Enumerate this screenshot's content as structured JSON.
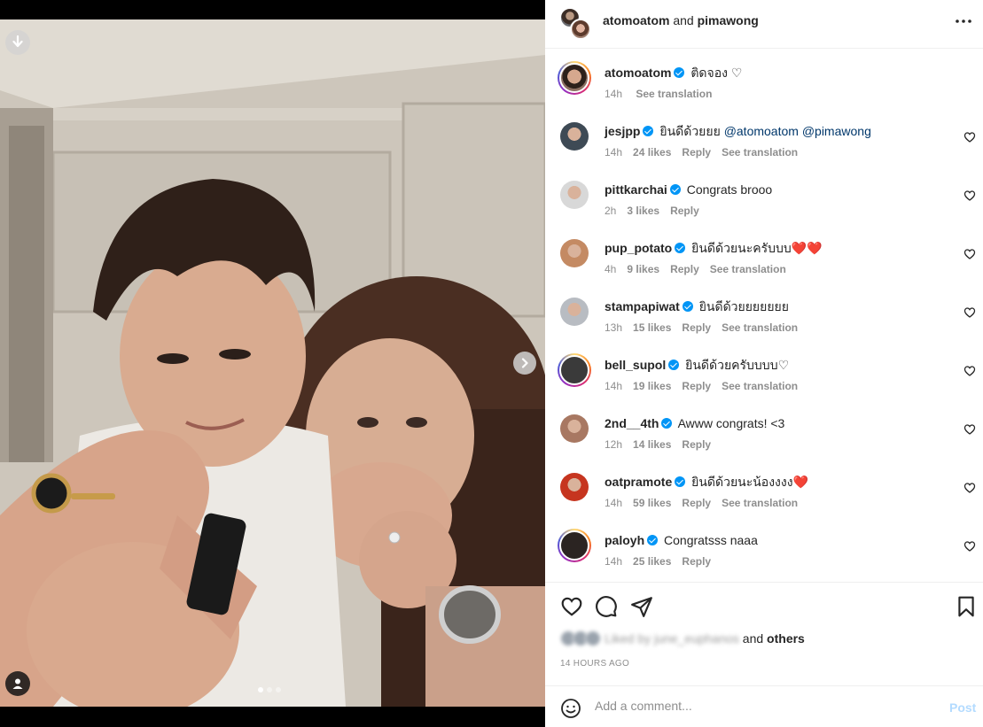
{
  "header": {
    "owner": "atomoatom",
    "joiner": "and",
    "collaborator": "pimawong",
    "more_icon": "more-horizontal-icon"
  },
  "caption": {
    "username": "atomoatom",
    "text": "ติดจอง",
    "emoji": "♡",
    "time": "14h",
    "translate": "See translation"
  },
  "comments": [
    {
      "username": "jesjpp",
      "text": "ยินดีด้วยยย",
      "mentions": [
        "@atomoatom",
        "@pimawong"
      ],
      "time": "14h",
      "likes": "24 likes",
      "reply": "Reply",
      "translate": "See translation",
      "avatar_color": "#3e4a55"
    },
    {
      "username": "pittkarchai",
      "text": "Congrats brooo",
      "mentions": [],
      "time": "2h",
      "likes": "3 likes",
      "reply": "Reply",
      "translate": "",
      "avatar_color": "#d8d8d8"
    },
    {
      "username": "pup_potato",
      "text": "ยินดีด้วยนะครับบบ❤️❤️",
      "mentions": [],
      "time": "4h",
      "likes": "9 likes",
      "reply": "Reply",
      "translate": "See translation",
      "avatar_color": "#c48a63"
    },
    {
      "username": "stampapiwat",
      "text": "ยินดีด้วยยยยยยย",
      "mentions": [],
      "time": "13h",
      "likes": "15 likes",
      "reply": "Reply",
      "translate": "See translation",
      "avatar_color": "#b8bcc2"
    },
    {
      "username": "bell_supol",
      "text": "ยินดีด้วยครับบบบ♡",
      "mentions": [],
      "time": "14h",
      "likes": "19 likes",
      "reply": "Reply",
      "translate": "See translation",
      "avatar_color": "#3a3a3a"
    },
    {
      "username": "2nd__4th",
      "text": "Awww congrats! <3",
      "mentions": [],
      "time": "12h",
      "likes": "14 likes",
      "reply": "Reply",
      "translate": "",
      "avatar_color": "#a87862"
    },
    {
      "username": "oatpramote",
      "text": "ยินดีด้วยนะน้องงงง❤️",
      "mentions": [],
      "time": "14h",
      "likes": "59 likes",
      "reply": "Reply",
      "translate": "See translation",
      "avatar_color": "#c6351f"
    },
    {
      "username": "paloyh",
      "text": "Congratsss naaa",
      "mentions": [],
      "time": "14h",
      "likes": "25 likes",
      "reply": "Reply",
      "translate": "",
      "avatar_color": "#2b2422"
    }
  ],
  "actions": {
    "like_icon": "heart-icon",
    "comment_icon": "comment-icon",
    "share_icon": "send-icon",
    "save_icon": "bookmark-icon"
  },
  "likes_summary": {
    "blurred_text": "Liked by june_euphanos",
    "joiner": "and",
    "others": "others"
  },
  "timestamp": "14 HOURS AGO",
  "add_comment": {
    "placeholder": "Add a comment...",
    "post_label": "Post",
    "emoji_icon": "smiley-icon"
  },
  "media": {
    "slides": 3,
    "active_slide": 1,
    "download_icon": "download-icon",
    "next_icon": "chevron-right-icon",
    "tag_icon": "user-tag-icon"
  },
  "colors": {
    "verified": "#0095f6",
    "link": "#00376b",
    "muted": "#8e8e8e",
    "post_disabled": "#b3dbff"
  }
}
